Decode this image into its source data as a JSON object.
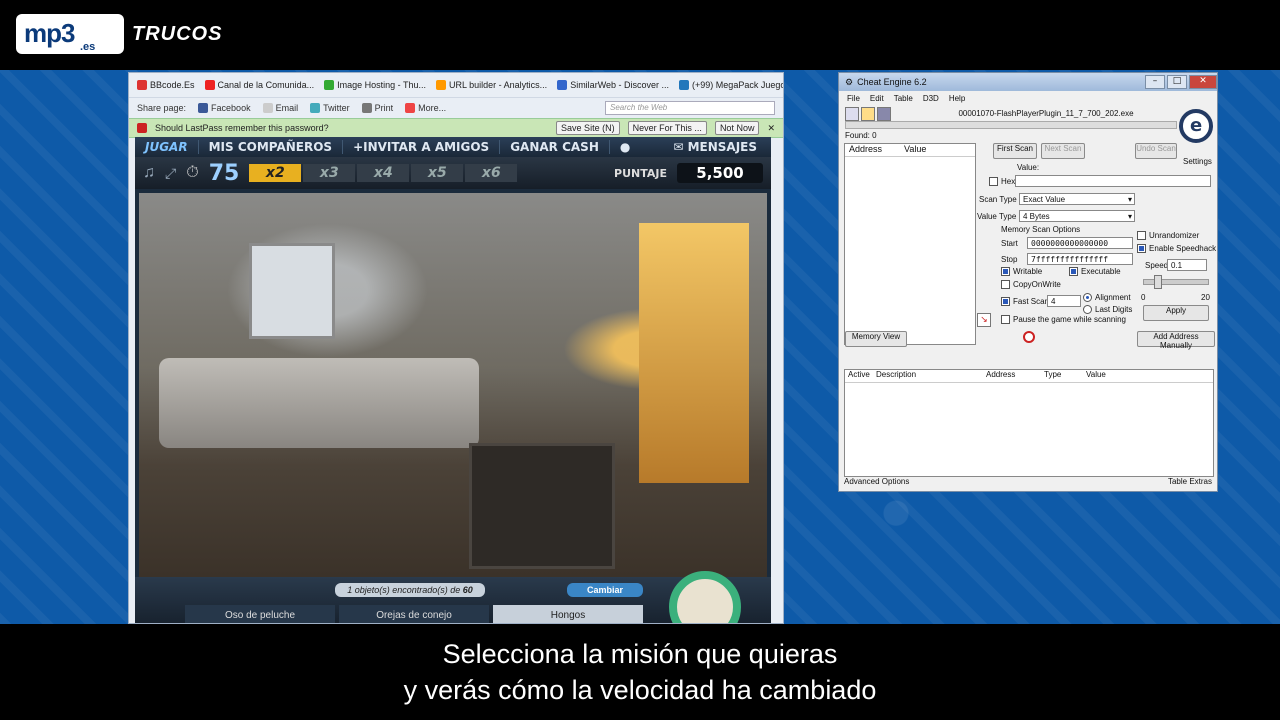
{
  "overlay": {
    "logo_text": "mp3",
    "logo_suffix": ".es",
    "section": "TRUCOS",
    "subtitle_line1": "Selecciona la misión que quieras",
    "subtitle_line2": "y verás cómo la velocidad ha cambiado"
  },
  "browser": {
    "bookmarks": [
      {
        "label": "BBcode.Es",
        "icon": "bbcode-icon",
        "color": "#d33"
      },
      {
        "label": "Canal de la Comunida...",
        "icon": "youtube-icon",
        "color": "#e22"
      },
      {
        "label": "Image Hosting - Thu...",
        "icon": "image-icon",
        "color": "#3a3"
      },
      {
        "label": "URL builder - Analytics...",
        "icon": "analytics-icon",
        "color": "#f90"
      },
      {
        "label": "SimilarWeb - Discover ...",
        "icon": "similarweb-icon",
        "color": "#36c"
      },
      {
        "label": "(+99) MegaPack Juego...",
        "icon": "page-icon",
        "color": "#27b"
      }
    ],
    "share_label": "Share page:",
    "share_items": [
      {
        "label": "Facebook",
        "icon": "facebook-icon"
      },
      {
        "label": "Email",
        "icon": "email-icon"
      },
      {
        "label": "Twitter",
        "icon": "twitter-icon"
      },
      {
        "label": "Print",
        "icon": "print-icon"
      },
      {
        "label": "More...",
        "icon": "plus-icon"
      }
    ],
    "search_placeholder": "Search the Web",
    "lastpass_question": "Should LastPass remember this password?",
    "lastpass_buttons": [
      "Save Site (N)",
      "Never For This ...",
      "Not Now"
    ]
  },
  "game": {
    "nav": [
      "JUGAR",
      "MIS COMPAÑEROS",
      "+INVITAR A AMIGOS",
      "GANAR CASH",
      "MENSAJES"
    ],
    "timer": "75",
    "multipliers": [
      "x2",
      "x3",
      "x4",
      "x5",
      "x6"
    ],
    "active_multiplier": "x2",
    "score_label": "PUNTAJE",
    "score": "5,500",
    "found_count": "1",
    "found_text_mid": "objeto(s) encontrado(s) de",
    "found_total": "60",
    "cambiar": "Cambiar",
    "tasks": [
      "Oso de peluche",
      "Orejas de conejo",
      "Hongos"
    ],
    "active_task": "Hongos"
  },
  "cheat_engine": {
    "title": "Cheat Engine 6.2",
    "menu": [
      "File",
      "Edit",
      "Table",
      "D3D",
      "Help"
    ],
    "process": "00001070-FlashPlayerPlugin_11_7_700_202.exe",
    "found": "Found: 0",
    "list_headers": [
      "Address",
      "Value"
    ],
    "first_scan": "First Scan",
    "next_scan": "Next Scan",
    "undo_scan": "Undo Scan",
    "settings": "Settings",
    "value_label": "Value:",
    "hex_label": "Hex",
    "scan_type_label": "Scan Type",
    "scan_type": "Exact Value",
    "value_type_label": "Value Type",
    "value_type": "4 Bytes",
    "memory_scan_options": "Memory Scan Options",
    "start_label": "Start",
    "start_value": "0000000000000000",
    "stop_label": "Stop",
    "stop_value": "7fffffffffffffff",
    "writable": "Writable",
    "executable": "Executable",
    "copyonwrite": "CopyOnWrite",
    "fast_scan": "Fast Scan",
    "fast_scan_value": "4",
    "alignment": "Alignment",
    "last_digits": "Last Digits",
    "pause_game": "Pause the game while scanning",
    "unrandomizer": "Unrandomizer",
    "enable_speedhack": "Enable Speedhack",
    "speed_label": "Speed",
    "speed_value": "0.1",
    "slider_min": "0",
    "slider_max": "20",
    "slider_position_fraction": 0.18,
    "apply": "Apply",
    "memory_view": "Memory View",
    "add_address": "Add Address Manually",
    "table_headers": [
      "Active",
      "Description",
      "Address",
      "Type",
      "Value"
    ],
    "advanced_options": "Advanced Options",
    "table_extras": "Table Extras"
  },
  "colors": {
    "background_blue": "#0e5aa8",
    "lastpass_green": "#c9e6b6",
    "multiplier_active": "#e8b020",
    "speedhack_ring": "#3bb07c"
  }
}
